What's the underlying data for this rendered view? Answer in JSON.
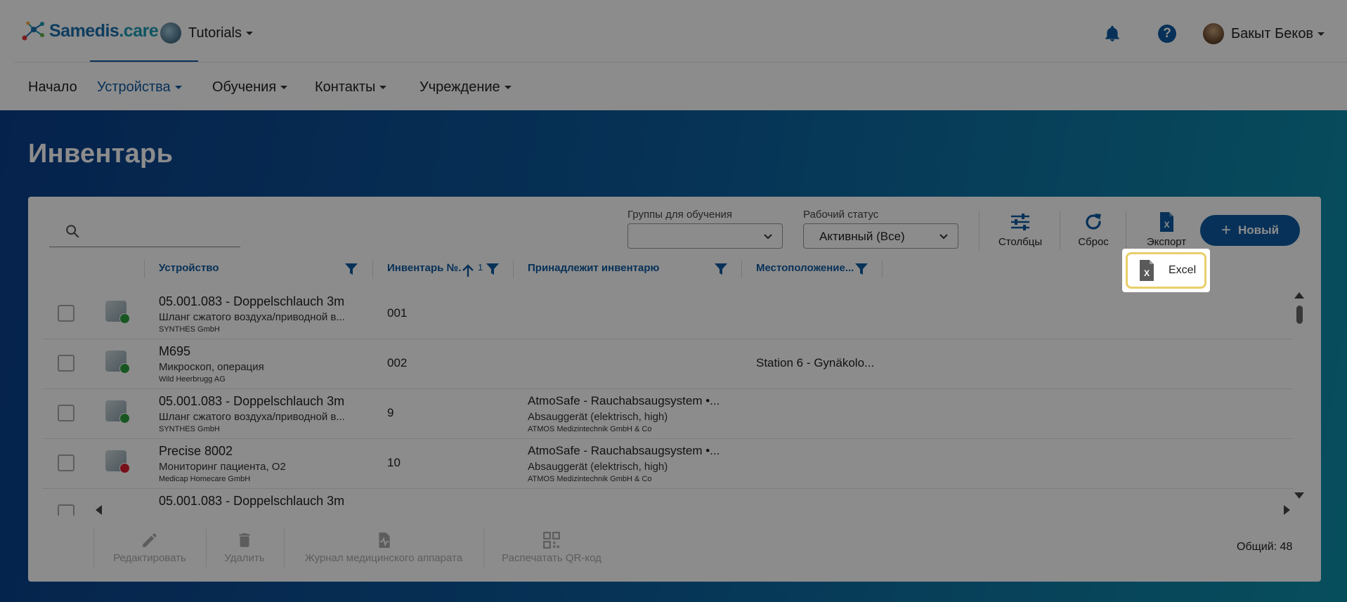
{
  "header": {
    "logo_main": "Samedis",
    "logo_suffix": ".care",
    "tenant": "Tutorials",
    "user": "Бакыт Беков",
    "help_symbol": "?"
  },
  "nav": {
    "items": [
      {
        "label": "Начало"
      },
      {
        "label": "Устройства"
      },
      {
        "label": "Обучения"
      },
      {
        "label": "Контакты"
      },
      {
        "label": "Учреждение"
      }
    ]
  },
  "page": {
    "title": "Инвентарь"
  },
  "toolbar": {
    "search_placeholder": "",
    "training_groups_label": "Группы для обучения",
    "training_groups_value": "",
    "work_status_label": "Рабочий статус",
    "work_status_value": "Активный (Все)",
    "columns_label": "Столбцы",
    "reset_label": "Сброс",
    "export_label": "Экспорт",
    "new_label": "Новый"
  },
  "export_menu": {
    "excel_label": "Excel"
  },
  "table": {
    "columns": {
      "device": "Устройство",
      "inventory_no": "Инвентарь №.",
      "sort_index": "1",
      "parent": "Принадлежит инвентарю",
      "location": "Местоположение..."
    },
    "rows": [
      {
        "name": "05.001.083 - Doppelschlauch 3m",
        "category": "Шланг сжатого воздуха/приводной в...",
        "manufacturer": "SYNTHES GmbH",
        "inventory_no": "001",
        "parent_name": "",
        "parent_category": "",
        "parent_manufacturer": "",
        "location": "",
        "status_color": "#2e9e3e"
      },
      {
        "name": "M695",
        "category": "Микроскоп, операция",
        "manufacturer": "Wild Heerbrugg AG",
        "inventory_no": "002",
        "parent_name": "",
        "parent_category": "",
        "parent_manufacturer": "",
        "location": "Station 6 - Gynäkolo...",
        "status_color": "#2e9e3e"
      },
      {
        "name": "05.001.083 - Doppelschlauch 3m",
        "category": "Шланг сжатого воздуха/приводной в...",
        "manufacturer": "SYNTHES GmbH",
        "inventory_no": "9",
        "parent_name": "AtmoSafe - Rauchabsaugsystem •...",
        "parent_category": "Absauggerät (elektrisch, high)",
        "parent_manufacturer": "ATMOS Medizintechnik GmbH & Co",
        "location": "",
        "status_color": "#2e9e3e"
      },
      {
        "name": "Precise 8002",
        "category": "Мониторинг пациента, O2",
        "manufacturer": "Medicap Homecare GmbH",
        "inventory_no": "10",
        "parent_name": "AtmoSafe - Rauchabsaugsystem •...",
        "parent_category": "Absauggerät (elektrisch, high)",
        "parent_manufacturer": "ATMOS Medizintechnik GmbH & Co",
        "location": "",
        "status_color": "#d8202f"
      },
      {
        "name": "05.001.083 - Doppelschlauch 3m",
        "category": "",
        "manufacturer": "",
        "inventory_no": "",
        "parent_name": "",
        "parent_category": "",
        "parent_manufacturer": "",
        "location": "",
        "status_color": "#2e9e3e"
      }
    ]
  },
  "actions": {
    "edit": "Редактировать",
    "delete": "Удалить",
    "journal": "Журнал медицинского аппарата",
    "print_qr": "Распечатать QR-код"
  },
  "footer": {
    "total": "Общий: 48"
  },
  "colors": {
    "accent": "#0e5aa0",
    "highlight": "#e8cf6a",
    "status_ok": "#2e9e3e",
    "status_error": "#d8202f"
  }
}
